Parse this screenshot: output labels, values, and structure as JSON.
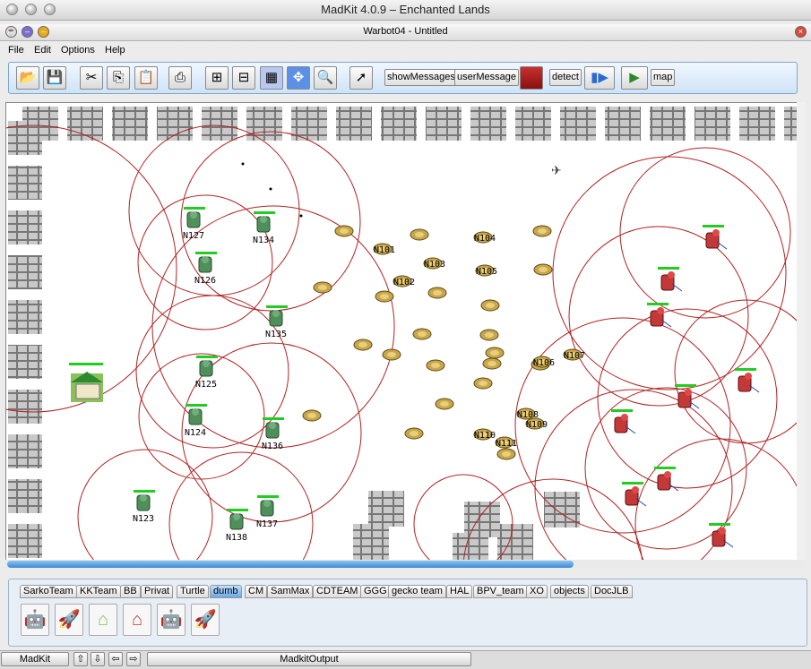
{
  "app": {
    "title": "MadKit 4.0.9 – Enchanted Lands"
  },
  "frame": {
    "title": "Warbot04 - Untitled"
  },
  "menu": [
    "File",
    "Edit",
    "Options",
    "Help"
  ],
  "toolbar": {
    "show_messages": "showMessages",
    "user_message": "userMessage",
    "detect": "detect",
    "map": "map"
  },
  "world": {
    "green_labels": [
      "N127",
      "N134",
      "N126",
      "N135",
      "N125",
      "N124",
      "N136",
      "N123",
      "N137",
      "N138"
    ],
    "resource_labels": [
      "N101",
      "N102",
      "N103",
      "N104",
      "N105",
      "N106",
      "N107",
      "N108",
      "N109",
      "N110",
      "N111"
    ]
  },
  "tabs": [
    "SarkoTeam",
    "KKTeam",
    "BB",
    "Privat",
    "Turtle",
    "dumb",
    "CM",
    "SamMax",
    "CDTEAM",
    "GGG",
    "gecko team",
    "HAL",
    "BPV_team",
    "XO",
    "objects",
    "DocJLB"
  ],
  "selected_tab": "dumb",
  "palette_icons": [
    "green-robot-icon",
    "green-rocket-launcher-icon",
    "green-base-icon",
    "red-base-icon",
    "red-robot-icon",
    "red-rocket-launcher-icon"
  ],
  "taskbar": {
    "madkit": "MadKit",
    "output": "MadkitOutput"
  },
  "colors": {
    "accent": "#3a8ad6",
    "perception_circle": "#b22222",
    "energy_bar": "#22cc22"
  }
}
